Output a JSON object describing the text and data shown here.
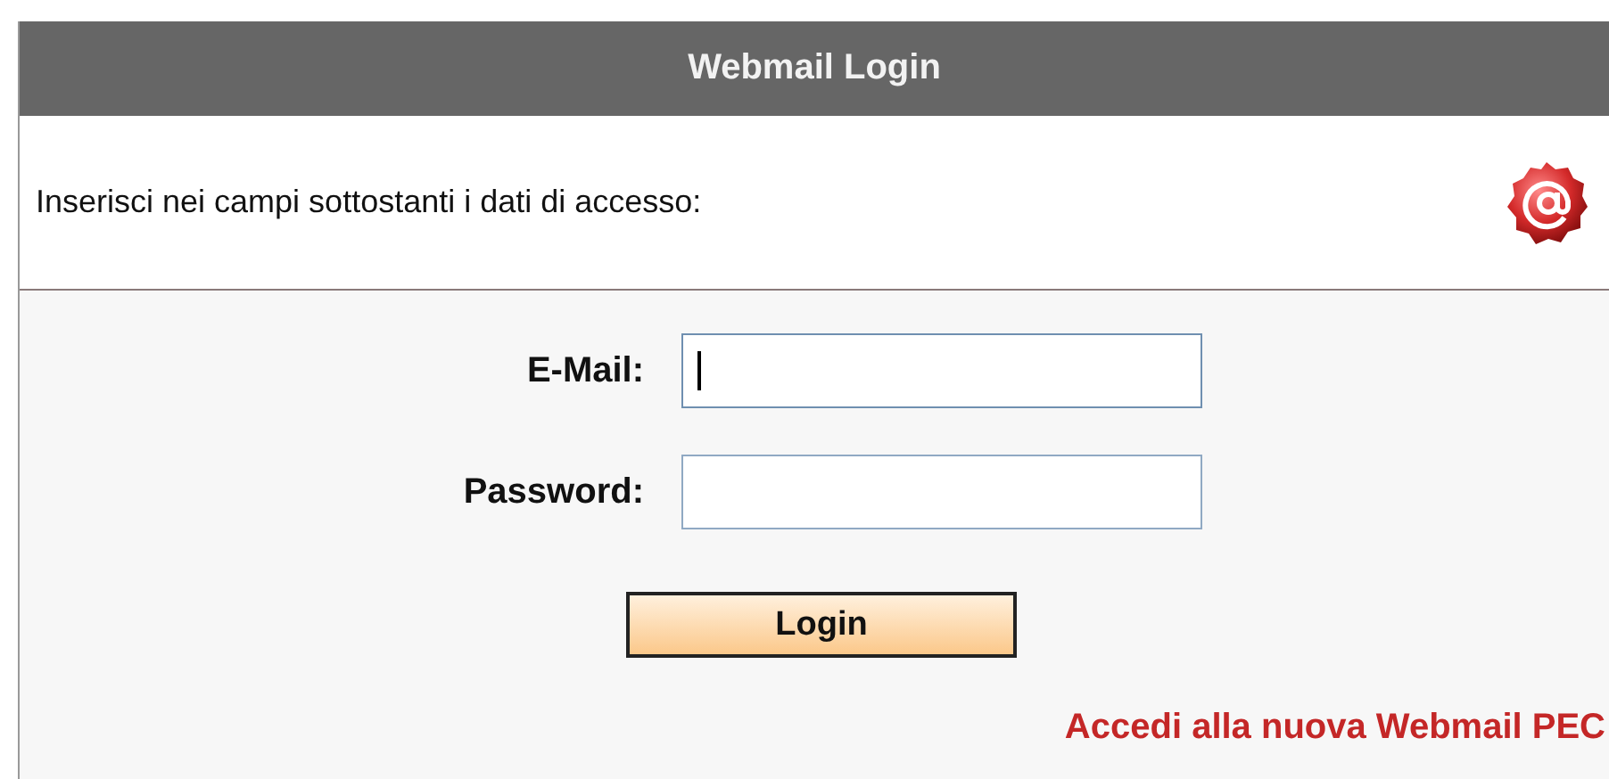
{
  "header": {
    "title": "Webmail Login"
  },
  "intro": {
    "text": "Inserisci nei campi sottostanti i dati di accesso:"
  },
  "form": {
    "fields": [
      {
        "label": "E-Mail:",
        "focused": true
      },
      {
        "label": "Password:",
        "focused": false
      }
    ],
    "button": "Login",
    "link": "Accedi alla nuova Webmail PEC"
  }
}
